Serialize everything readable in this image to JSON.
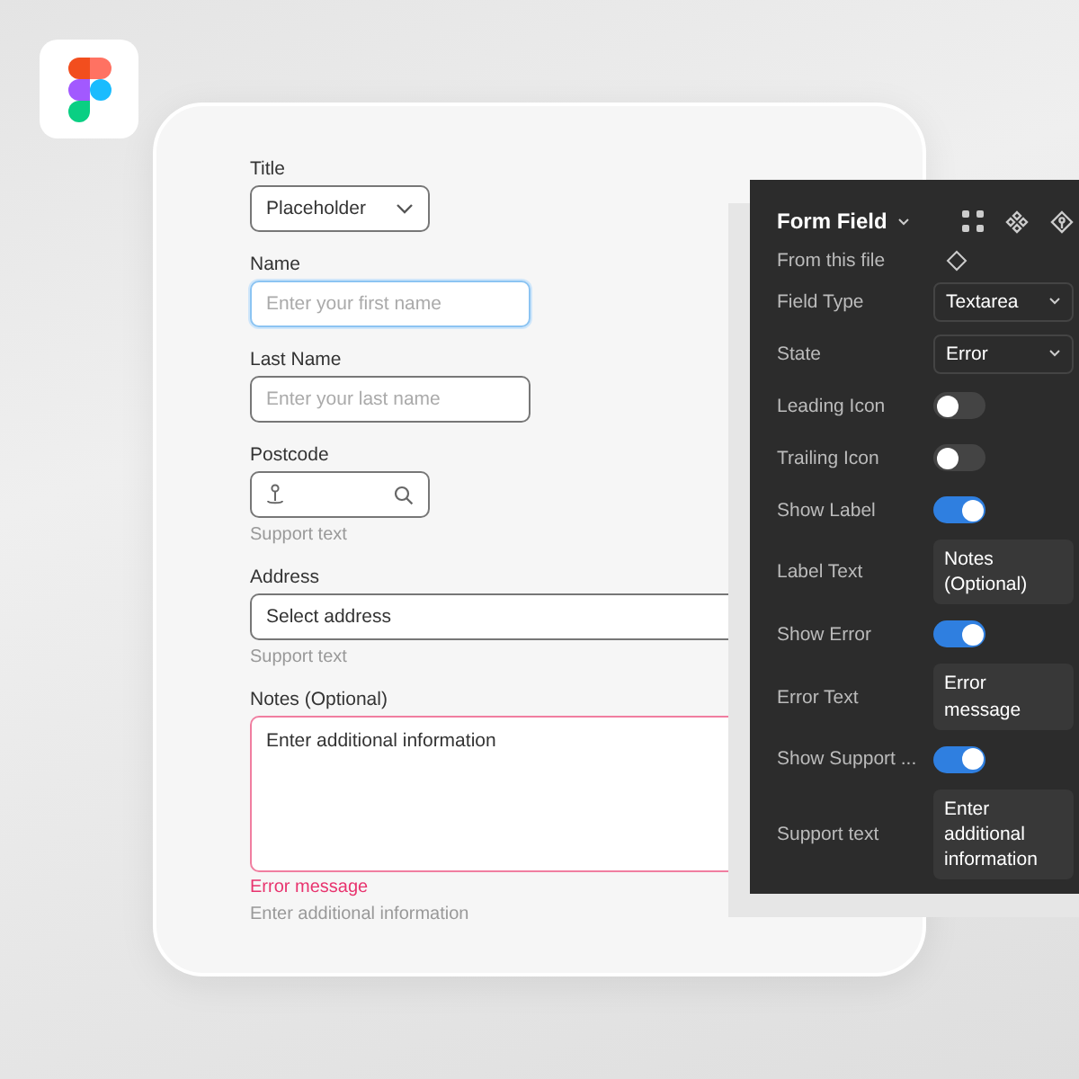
{
  "form": {
    "title_field": {
      "label": "Title",
      "value": "Placeholder"
    },
    "name_field": {
      "label": "Name",
      "placeholder": "Enter your first name",
      "focused": true
    },
    "last_name_field": {
      "label": "Last Name",
      "placeholder": "Enter your last name"
    },
    "postcode_field": {
      "label": "Postcode",
      "support": "Support text"
    },
    "address_field": {
      "label": "Address",
      "value": "Select address",
      "support": "Support text"
    },
    "notes_field": {
      "label": "Notes (Optional)",
      "value": "Enter additional information",
      "error": "Error message",
      "support": "Enter additional information"
    }
  },
  "properties_panel": {
    "title": "Form Field",
    "source": "From this file",
    "rows": [
      {
        "kind": "select",
        "label": "Field Type",
        "value": "Textarea"
      },
      {
        "kind": "select",
        "label": "State",
        "value": "Error"
      },
      {
        "kind": "toggle",
        "label": "Leading Icon",
        "on": false
      },
      {
        "kind": "toggle",
        "label": "Trailing Icon",
        "on": false
      },
      {
        "kind": "toggle",
        "label": "Show Label",
        "on": true
      },
      {
        "kind": "text",
        "label": "Label Text",
        "value": "Notes (Optional)"
      },
      {
        "kind": "toggle",
        "label": "Show Error",
        "on": true
      },
      {
        "kind": "text",
        "label": "Error Text",
        "value": "Error message"
      },
      {
        "kind": "toggle",
        "label": "Show Support ...",
        "on": true
      },
      {
        "kind": "text",
        "label": "Support text",
        "value": "Enter additional information"
      }
    ]
  }
}
